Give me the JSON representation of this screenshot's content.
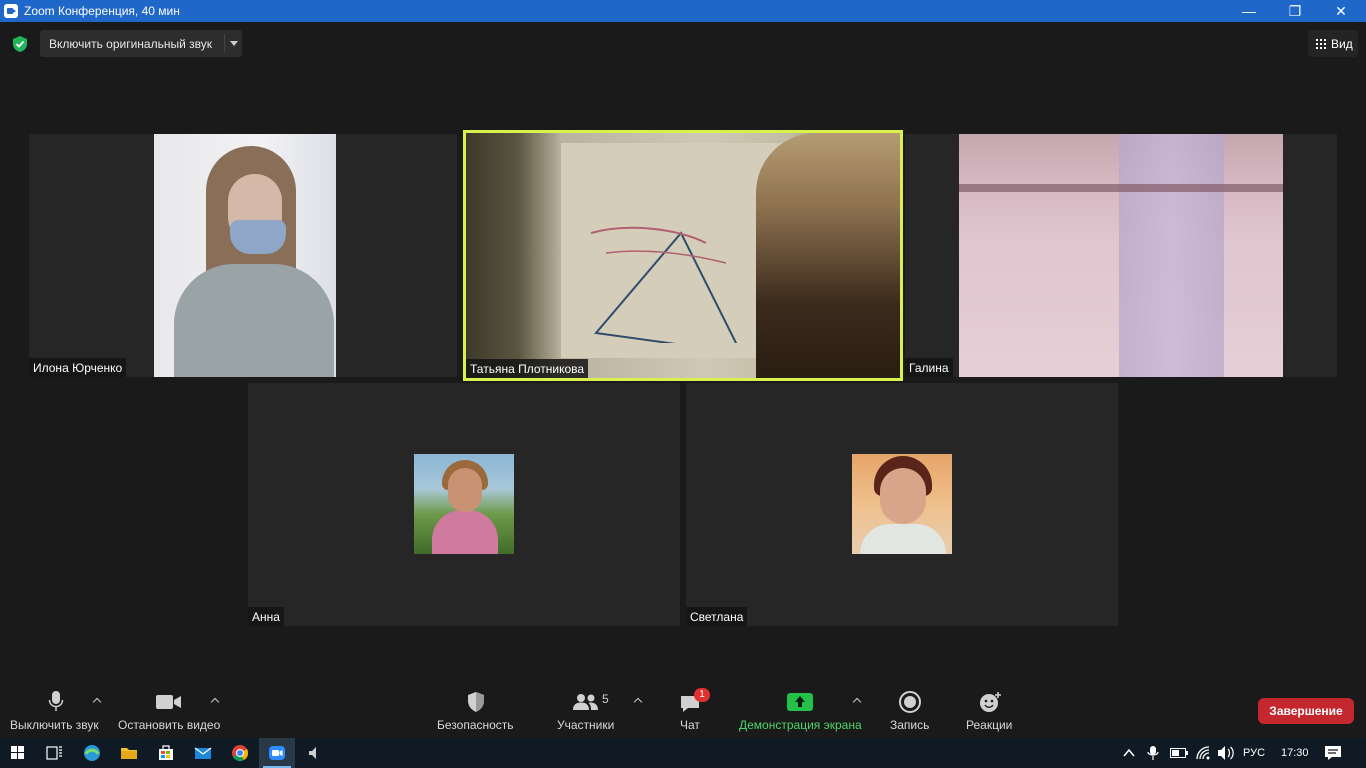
{
  "window": {
    "title": "Zoom Конференция, 40 мин",
    "minimize": "—",
    "maximize": "❐",
    "close": "✕"
  },
  "topbar": {
    "original_sound_label": "Включить оригинальный звук",
    "view_label": "Вид"
  },
  "participants": [
    {
      "name": "Илона Юрченко",
      "video": true,
      "active_speaker": false
    },
    {
      "name": "Татьяна Плотникова",
      "video": true,
      "active_speaker": true
    },
    {
      "name": "Галина",
      "video": true,
      "active_speaker": false
    },
    {
      "name": "Анна",
      "video": false,
      "active_speaker": false
    },
    {
      "name": "Светлана",
      "video": false,
      "active_speaker": false
    }
  ],
  "toolbar": {
    "mute_label": "Выключить звук",
    "video_label": "Остановить видео",
    "security_label": "Безопасность",
    "participants_label": "Участники",
    "participants_count": "5",
    "chat_label": "Чат",
    "chat_badge": "1",
    "share_label": "Демонстрация экрана",
    "record_label": "Запись",
    "reactions_label": "Реакции",
    "end_label": "Завершение"
  },
  "taskbar": {
    "language": "РУС",
    "time": "17:30"
  },
  "colors": {
    "titlebar": "#1f67c9",
    "active_speaker_border": "#d9f14d",
    "share_green": "#4fd36a",
    "end_red": "#c5272f"
  }
}
